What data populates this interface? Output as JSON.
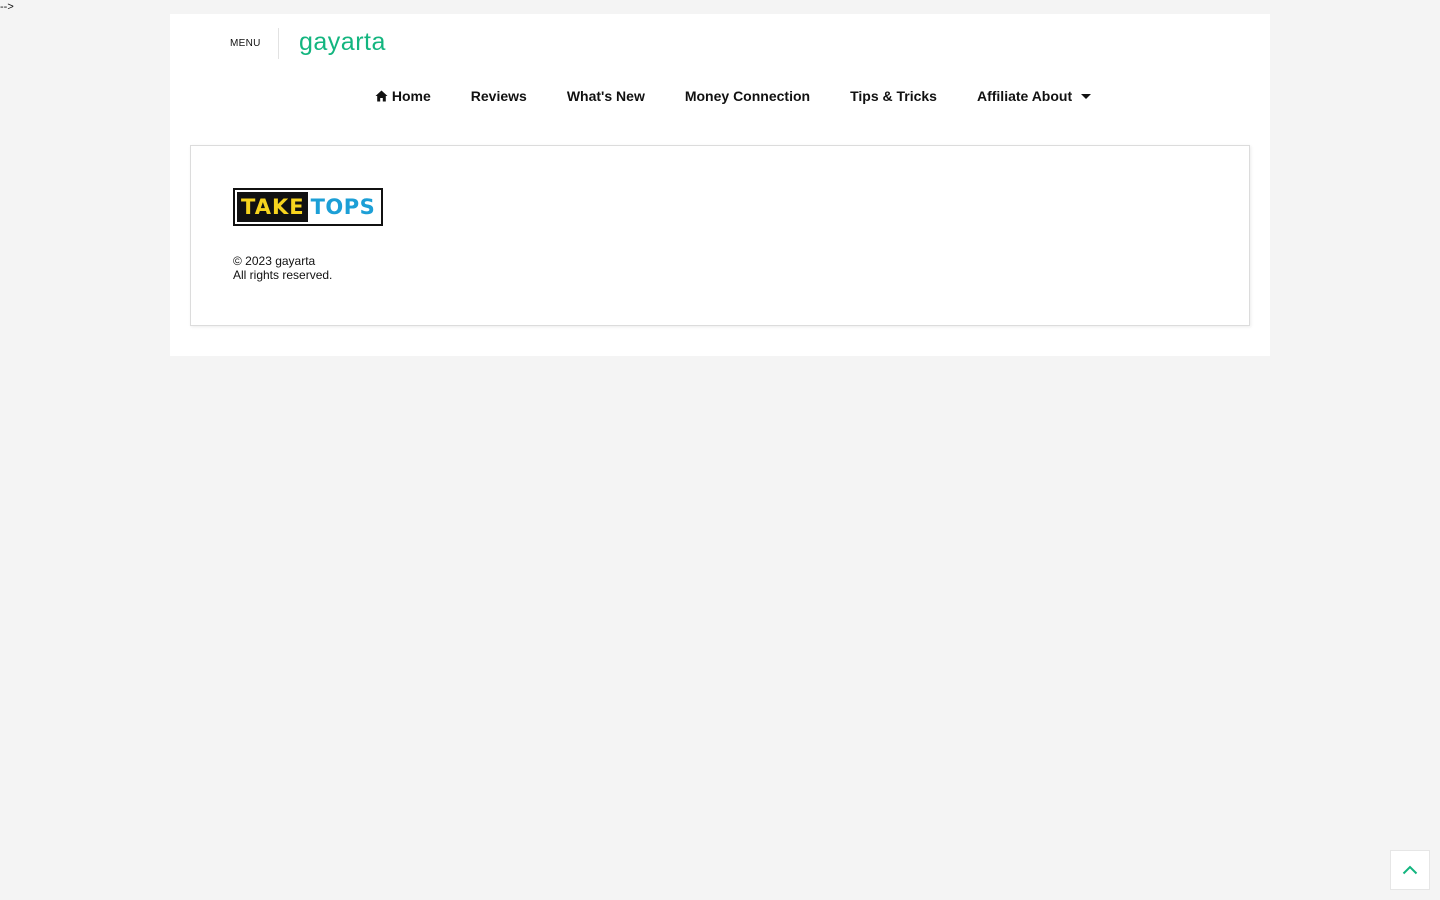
{
  "stray_text": "-->",
  "header": {
    "menu_label": "MENU",
    "site_title": "gayarta"
  },
  "nav": {
    "items": [
      {
        "label": "Home",
        "icon": "home-icon"
      },
      {
        "label": "Reviews"
      },
      {
        "label": "What's New"
      },
      {
        "label": "Money Connection"
      },
      {
        "label": "Tips & Tricks"
      },
      {
        "label": "Affiliate About",
        "icon": "caret-down-icon"
      }
    ]
  },
  "footer": {
    "logo": {
      "part1": "TAKE",
      "part2": "TOPS"
    },
    "copyright_line1": "© 2023 gayarta",
    "copyright_line2": "All rights reserved."
  },
  "back_to_top": {
    "icon": "chevron-up-icon"
  },
  "colors": {
    "page_bg": "#f4f4f4",
    "accent": "#13b57f",
    "logo_yellow": "#f7d41e",
    "logo_blue": "#1c9fd6"
  }
}
